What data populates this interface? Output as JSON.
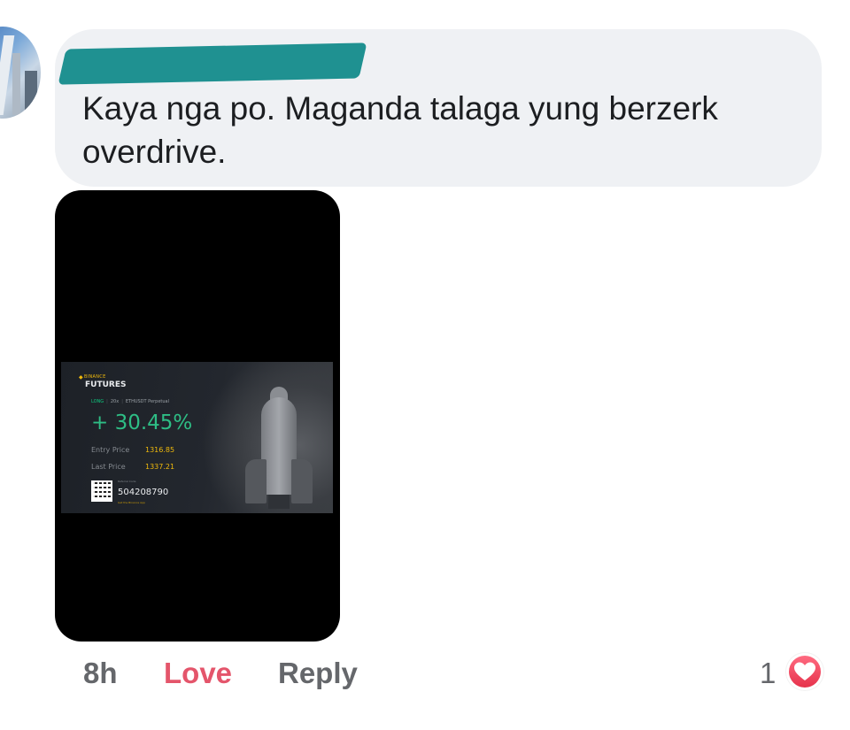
{
  "comment": {
    "text": "Kaya nga po. Maganda talaga yung berzerk overdrive.",
    "author_name_redacted": true,
    "redaction_color": "#1f9191"
  },
  "attachment": {
    "card": {
      "brand_small": "BINANCE",
      "brand_big": "FUTURES",
      "position_side": "LONG",
      "leverage": "20x",
      "contract": "ETHUSDT Perpetual",
      "pnl_percent": "+ 30.45%",
      "entry_price_label": "Entry Price",
      "entry_price": "1316.85",
      "last_price_label": "Last Price",
      "last_price": "1337.21",
      "referral_label": "Referral Code",
      "referral_code": "504208790",
      "app_label": "Get the Binance App",
      "accent_green": "#2ebd85",
      "accent_yellow": "#f0b90b"
    }
  },
  "actions": {
    "time": "8h",
    "love_label": "Love",
    "reply_label": "Reply",
    "love_color": "#e4556b"
  },
  "reactions": {
    "count": "1",
    "icon": "heart-icon",
    "color": "#e6324b"
  }
}
